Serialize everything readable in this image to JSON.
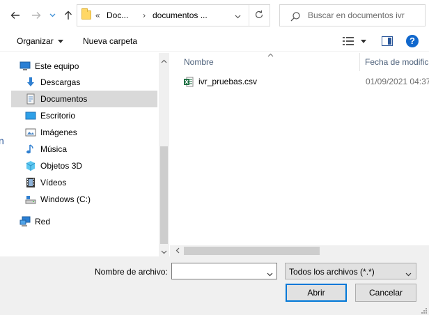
{
  "address": {
    "prefix": "«",
    "crumb_short": "Doc...",
    "separator": "›",
    "crumb_current": "documentos ..."
  },
  "search": {
    "placeholder": "Buscar en documentos ivr"
  },
  "toolbar": {
    "organize_label": "Organizar",
    "new_folder_label": "Nueva carpeta"
  },
  "nav": {
    "items": [
      {
        "label": "Este equipo",
        "icon": "computer-icon"
      },
      {
        "label": "Descargas",
        "icon": "downloads-icon"
      },
      {
        "label": "Documentos",
        "icon": "documents-icon",
        "selected": true
      },
      {
        "label": "Escritorio",
        "icon": "desktop-icon"
      },
      {
        "label": "Imágenes",
        "icon": "pictures-icon"
      },
      {
        "label": "Música",
        "icon": "music-icon"
      },
      {
        "label": "Objetos 3D",
        "icon": "objects-3d-icon"
      },
      {
        "label": "Vídeos",
        "icon": "videos-icon"
      },
      {
        "label": "Windows (C:)",
        "icon": "drive-icon"
      },
      {
        "label": "Red",
        "icon": "network-icon"
      }
    ]
  },
  "file_list": {
    "columns": [
      "Nombre",
      "Fecha de modific"
    ],
    "rows": [
      {
        "name": "ivr_pruebas.csv",
        "date": "01/09/2021 04:37",
        "icon": "excel-csv-icon"
      }
    ]
  },
  "bottom": {
    "filename_label": "Nombre de archivo:",
    "filename_value": "",
    "filetype_value": "Todos los archivos (*.*)",
    "open_label": "Abrir",
    "cancel_label": "Cancelar"
  },
  "colors": {
    "accent": "#0078d7",
    "selection": "#d9d9d9",
    "folder": "#ffd766",
    "excel": "#1d6f42",
    "bottom_bg": "#f0f0f0"
  }
}
